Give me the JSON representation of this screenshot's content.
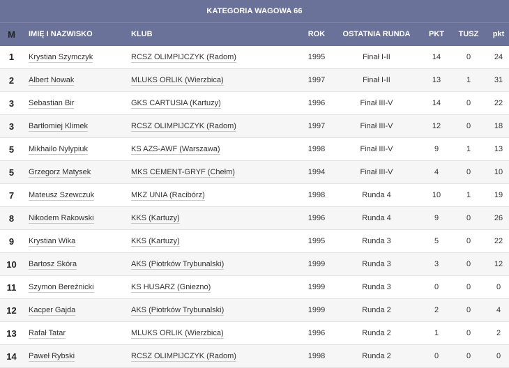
{
  "title": "KATEGORIA WAGOWA 66",
  "columns": [
    "M",
    "IMIĘ I NAZWISKO",
    "KLUB",
    "ROK",
    "OSTATNIA RUNDA",
    "PKT",
    "TUSZ",
    "pkt"
  ],
  "rows": [
    {
      "m": "1",
      "name": "Krystian Szymczyk",
      "club": "RCSZ OLIMPIJCZYK (Radom)",
      "rok": "1995",
      "runda": "Finał I-II",
      "pkt": "14",
      "tusz": "0",
      "pkt2": "24"
    },
    {
      "m": "2",
      "name": "Albert Nowak",
      "club": "MLUKS ORLIK (Wierzbica)",
      "rok": "1997",
      "runda": "Finał I-II",
      "pkt": "13",
      "tusz": "1",
      "pkt2": "31"
    },
    {
      "m": "3",
      "name": "Sebastian Bir",
      "club": "GKS CARTUSIA (Kartuzy)",
      "rok": "1996",
      "runda": "Finał III-V",
      "pkt": "14",
      "tusz": "0",
      "pkt2": "22"
    },
    {
      "m": "3",
      "name": "Bartłomiej Klimek",
      "club": "RCSZ OLIMPIJCZYK (Radom)",
      "rok": "1997",
      "runda": "Finał III-V",
      "pkt": "12",
      "tusz": "0",
      "pkt2": "18"
    },
    {
      "m": "5",
      "name": "Mikhailo Nylypiuk",
      "club": "KS AZS-AWF (Warszawa)",
      "rok": "1998",
      "runda": "Finał III-V",
      "pkt": "9",
      "tusz": "1",
      "pkt2": "13"
    },
    {
      "m": "5",
      "name": "Grzegorz Matysek",
      "club": "MKS CEMENT-GRYF (Chełm)",
      "rok": "1994",
      "runda": "Finał III-V",
      "pkt": "4",
      "tusz": "0",
      "pkt2": "10"
    },
    {
      "m": "7",
      "name": "Mateusz Szewczuk",
      "club": "MKZ UNIA (Racibórz)",
      "rok": "1998",
      "runda": "Runda 4",
      "pkt": "10",
      "tusz": "1",
      "pkt2": "19"
    },
    {
      "m": "8",
      "name": "Nikodem Rakowski",
      "club": "KKS (Kartuzy)",
      "rok": "1996",
      "runda": "Runda 4",
      "pkt": "9",
      "tusz": "0",
      "pkt2": "26"
    },
    {
      "m": "9",
      "name": "Krystian Wika",
      "club": "KKS (Kartuzy)",
      "rok": "1995",
      "runda": "Runda 3",
      "pkt": "5",
      "tusz": "0",
      "pkt2": "22"
    },
    {
      "m": "10",
      "name": "Bartosz Skóra",
      "club": "AKS (Piotrków Trybunalski)",
      "rok": "1999",
      "runda": "Runda 3",
      "pkt": "3",
      "tusz": "0",
      "pkt2": "12"
    },
    {
      "m": "11",
      "name": "Szymon Bereźnicki",
      "club": "KS HUSARZ (Gniezno)",
      "rok": "1999",
      "runda": "Runda 3",
      "pkt": "0",
      "tusz": "0",
      "pkt2": "0"
    },
    {
      "m": "12",
      "name": "Kacper Gajda",
      "club": "AKS (Piotrków Trybunalski)",
      "rok": "1999",
      "runda": "Runda 2",
      "pkt": "2",
      "tusz": "0",
      "pkt2": "4"
    },
    {
      "m": "13",
      "name": "Rafał Tatar",
      "club": "MLUKS ORLIK (Wierzbica)",
      "rok": "1996",
      "runda": "Runda 2",
      "pkt": "1",
      "tusz": "0",
      "pkt2": "2"
    },
    {
      "m": "14",
      "name": "Paweł Rybski",
      "club": "RCSZ OLIMPIJCZYK (Radom)",
      "rok": "1998",
      "runda": "Runda 2",
      "pkt": "0",
      "tusz": "0",
      "pkt2": "0"
    }
  ],
  "colors": {
    "header_bg": "#6a7299",
    "header_text": "#ffffff",
    "row_alt": "#f6f6f6"
  }
}
